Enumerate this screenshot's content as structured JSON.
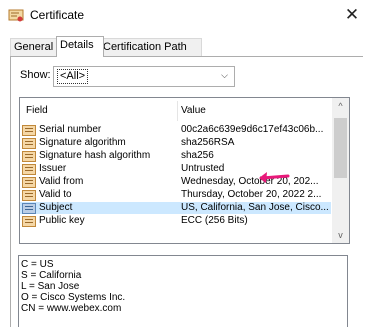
{
  "window": {
    "title": "Certificate",
    "close_glyph": "✕"
  },
  "tabs": [
    "General",
    "Details",
    "Certification Path"
  ],
  "show": {
    "label": "Show:",
    "value": "<All>",
    "arrow": "⌵"
  },
  "list": {
    "headers": {
      "field": "Field",
      "value": "Value"
    },
    "rows": [
      {
        "field": "Serial number",
        "value": "00c2a6c639e9d6c17ef43c06b...",
        "icon": "certificate-field-icon"
      },
      {
        "field": "Signature algorithm",
        "value": "sha256RSA",
        "icon": "certificate-field-icon"
      },
      {
        "field": "Signature hash algorithm",
        "value": "sha256",
        "icon": "certificate-field-icon"
      },
      {
        "field": "Issuer",
        "value": "Untrusted",
        "icon": "certificate-field-icon"
      },
      {
        "field": "Valid from",
        "value": "Wednesday, October 20, 202...",
        "icon": "certificate-field-icon"
      },
      {
        "field": "Valid to",
        "value": "Thursday, October 20, 2022 2...",
        "icon": "certificate-field-icon"
      },
      {
        "field": "Subject",
        "value": "US, California, San Jose, Cisco...",
        "icon": "certificate-subject-icon",
        "selected": true
      },
      {
        "field": "Public key",
        "value": "ECC (256 Bits)",
        "icon": "certificate-field-icon"
      }
    ],
    "scroll": {
      "up": "^",
      "down": "v"
    }
  },
  "annotation": {
    "color": "#e8197a"
  },
  "detail": {
    "lines": [
      "C = US",
      "S = California",
      "L = San Jose",
      "O = Cisco Systems Inc.",
      "CN = www.webex.com"
    ]
  }
}
